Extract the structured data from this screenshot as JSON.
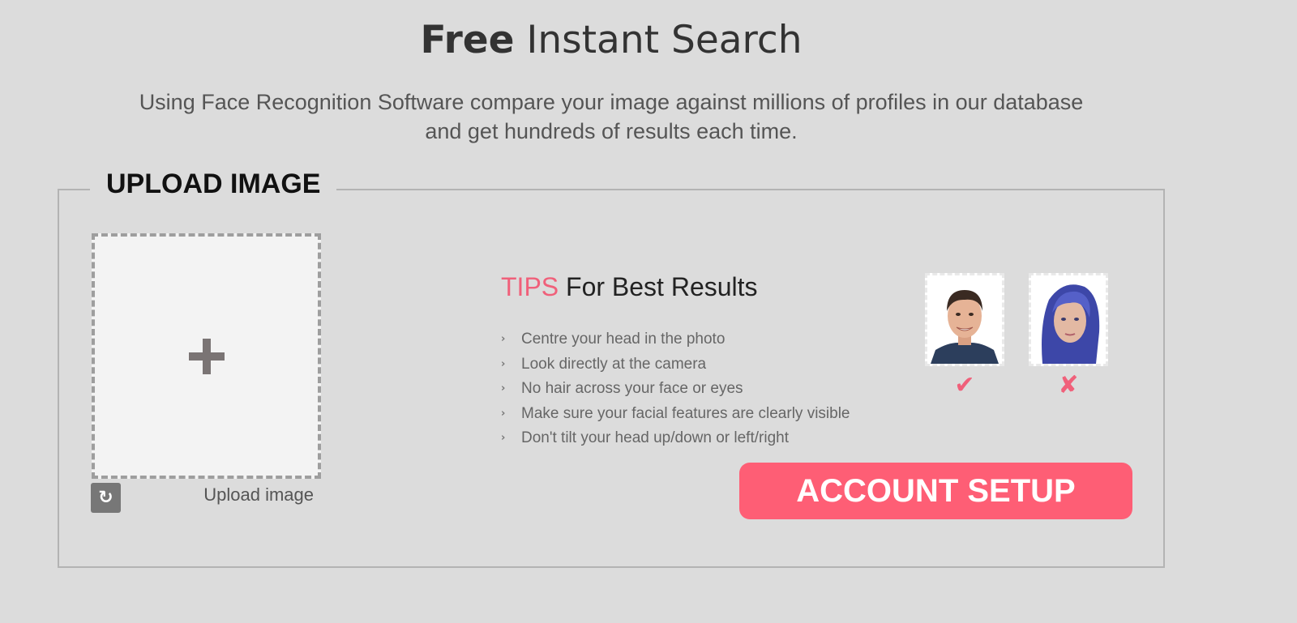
{
  "header": {
    "title_bold": "Free",
    "title_rest": "Instant Search",
    "subtitle_line1": "Using Face Recognition Software compare your image against millions of profiles in our database",
    "subtitle_line2": "and get hundreds of results each time."
  },
  "upload": {
    "legend": "UPLOAD IMAGE",
    "dropzone_icon": "plus-icon",
    "reset_icon": "refresh-icon",
    "label": "Upload image"
  },
  "tips": {
    "heading_accent": "TIPS",
    "heading_rest": "For Best Results",
    "items": [
      "Centre your head in the photo",
      "Look directly at the camera",
      "No hair across your face or eyes",
      "Make sure your facial features are clearly visible",
      "Don't tilt your head up/down or left/right"
    ]
  },
  "examples": {
    "good_mark": "✔",
    "bad_mark": "✘"
  },
  "cta": {
    "label": "ACCOUNT SETUP"
  },
  "colors": {
    "accent": "#fe5e75",
    "background": "#dcdcdc"
  }
}
